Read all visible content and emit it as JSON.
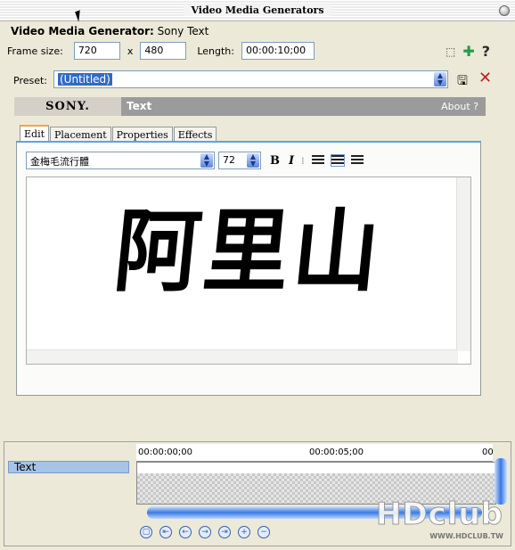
{
  "window": {
    "title": "Video Media Generators"
  },
  "header": {
    "label": "Video Media Generator:",
    "name": "Sony Text"
  },
  "frame": {
    "label": "Frame size:",
    "width": "720",
    "x": "x",
    "height": "480",
    "length_label": "Length:",
    "length": "00:00:10;00"
  },
  "preset": {
    "label": "Preset:",
    "value": "(Untitled)"
  },
  "plugin": {
    "brand": "SONY.",
    "title": "Text",
    "about": "About  ?"
  },
  "tabs": [
    {
      "label": "Edit"
    },
    {
      "label": "Placement"
    },
    {
      "label": "Properties"
    },
    {
      "label": "Effects"
    }
  ],
  "editor": {
    "font": "金梅毛流行體",
    "size": "72",
    "bold": "B",
    "italic": "I",
    "text": "阿里山"
  },
  "timeline": {
    "track_label": "Text",
    "ruler": [
      "00:00:00;00",
      "00:00:05;00",
      "00"
    ]
  },
  "watermark": {
    "text": "HDclub",
    "url": "WWW.HDCLUB.TW"
  },
  "colors": {
    "accent": "#316ac5",
    "tab_highlight": "#f5a34a",
    "sony_bar": "#9b9b9b"
  }
}
